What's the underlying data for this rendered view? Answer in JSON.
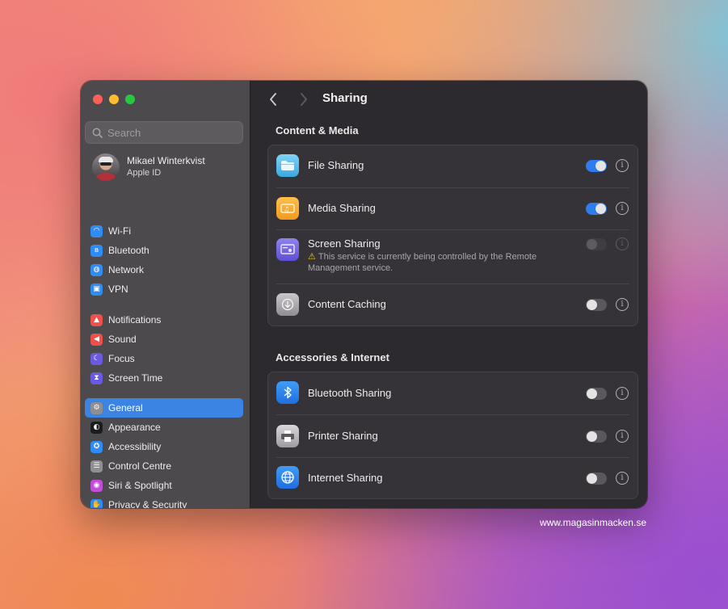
{
  "window": {
    "title": "Sharing",
    "search_placeholder": "Search"
  },
  "account": {
    "name": "Mikael Winterkvist",
    "subtitle": "Apple ID"
  },
  "sidebar": {
    "groups": [
      [
        {
          "label": "Wi-Fi",
          "icon": "wifi-icon",
          "color": "#2f8cf5",
          "glyph": "◠"
        },
        {
          "label": "Bluetooth",
          "icon": "bluetooth-icon",
          "color": "#2f8cf5",
          "glyph": "ʙ"
        },
        {
          "label": "Network",
          "icon": "globe-icon",
          "color": "#2f8cf5",
          "glyph": "◍"
        },
        {
          "label": "VPN",
          "icon": "vpn-icon",
          "color": "#2f8cf5",
          "glyph": "▣"
        }
      ],
      [
        {
          "label": "Notifications",
          "icon": "bell-icon",
          "color": "#f0504a",
          "glyph": "▲"
        },
        {
          "label": "Sound",
          "icon": "speaker-icon",
          "color": "#f0504a",
          "glyph": "◀"
        },
        {
          "label": "Focus",
          "icon": "moon-icon",
          "color": "#6a5ae0",
          "glyph": "☾"
        },
        {
          "label": "Screen Time",
          "icon": "hourglass-icon",
          "color": "#6a5ae0",
          "glyph": "⧗"
        }
      ],
      [
        {
          "label": "General",
          "icon": "gear-icon",
          "color": "#8e8e93",
          "glyph": "⚙",
          "active": true
        },
        {
          "label": "Appearance",
          "icon": "appearance-icon",
          "color": "#1c1c1e",
          "glyph": "◐"
        },
        {
          "label": "Accessibility",
          "icon": "accessibility-icon",
          "color": "#2f8cf5",
          "glyph": "✪"
        },
        {
          "label": "Control Centre",
          "icon": "control-centre-icon",
          "color": "#8e8e93",
          "glyph": "☰"
        },
        {
          "label": "Siri & Spotlight",
          "icon": "siri-icon",
          "color": "#c24ed8",
          "glyph": "◉"
        },
        {
          "label": "Privacy & Security",
          "icon": "hand-icon",
          "color": "#2f8cf5",
          "glyph": "✋"
        }
      ]
    ]
  },
  "sections": [
    {
      "title": "Content & Media",
      "rows": [
        {
          "label": "File Sharing",
          "icon": "folder-icon",
          "state": "on"
        },
        {
          "label": "Media Sharing",
          "icon": "media-icon",
          "state": "on"
        },
        {
          "label": "Screen Sharing",
          "icon": "screen-icon",
          "state": "disabled",
          "warning": "This service is currently being controlled by the Remote Management service."
        },
        {
          "label": "Content Caching",
          "icon": "download-icon",
          "state": "off"
        }
      ]
    },
    {
      "title": "Accessories & Internet",
      "rows": [
        {
          "label": "Bluetooth Sharing",
          "icon": "bluetooth-icon",
          "state": "off"
        },
        {
          "label": "Printer Sharing",
          "icon": "printer-icon",
          "state": "off"
        },
        {
          "label": "Internet Sharing",
          "icon": "globe-icon",
          "state": "off"
        }
      ]
    }
  ],
  "watermark": "www.magasinmacken.se"
}
